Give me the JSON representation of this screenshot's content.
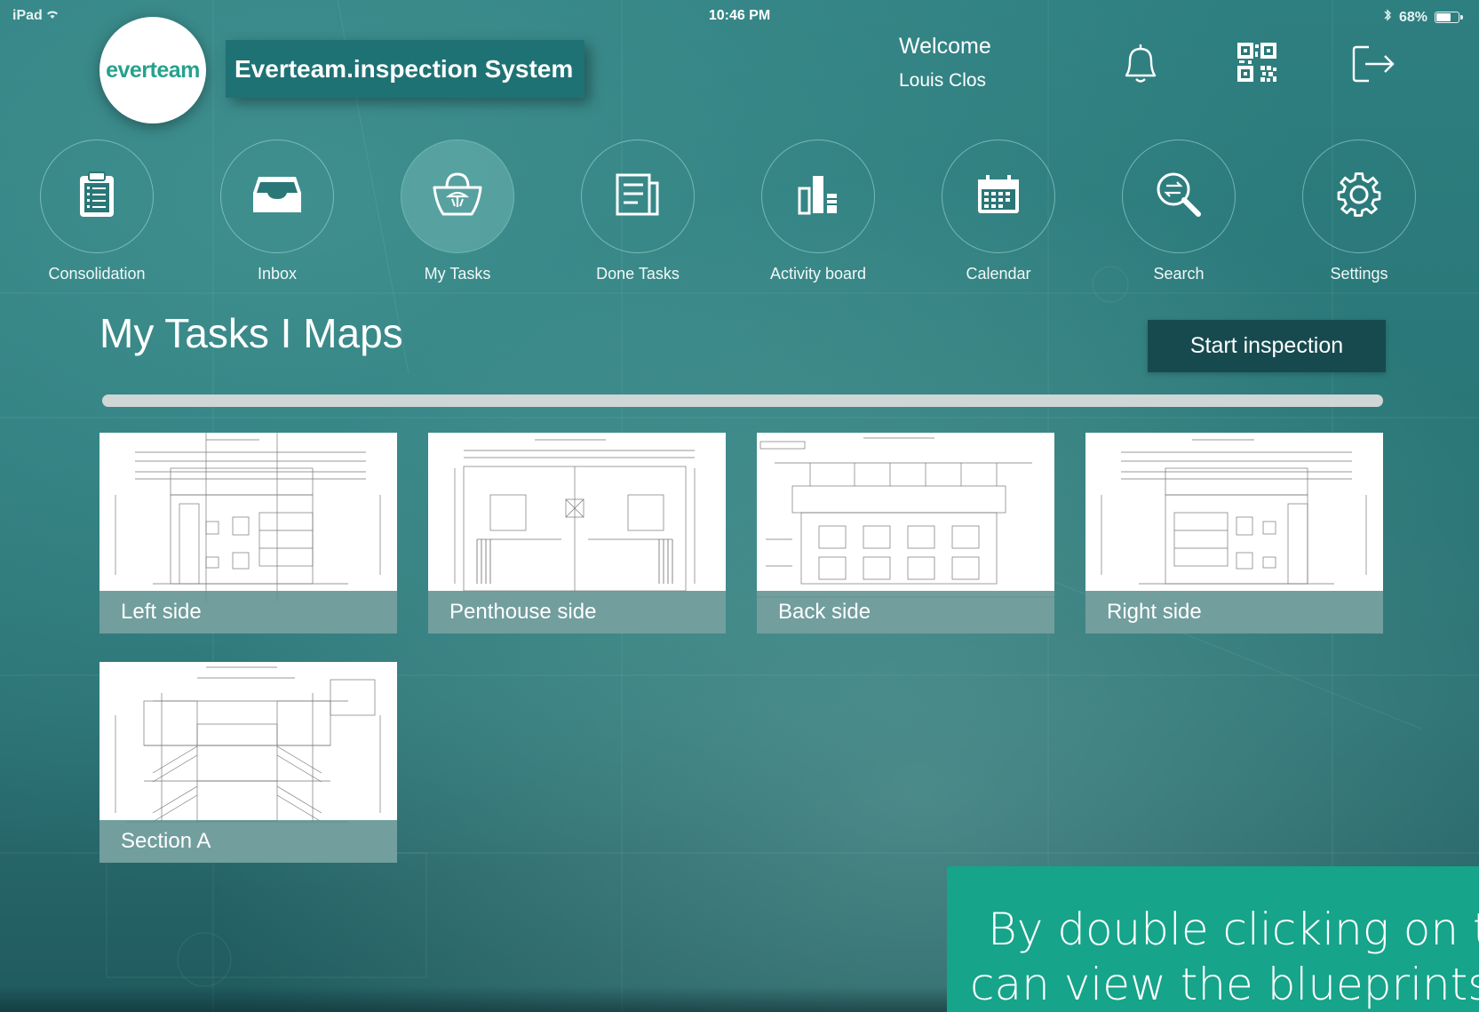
{
  "status_bar": {
    "device": "iPad",
    "time": "10:46 PM",
    "battery": "68%",
    "battery_level": 0.68
  },
  "header": {
    "logo": "everteam",
    "app_title": "Everteam.inspection System",
    "welcome": "Welcome",
    "user_name": "Louis Clos",
    "icons": [
      "bell-icon",
      "qr-code-icon",
      "logout-icon"
    ]
  },
  "nav": {
    "items": [
      {
        "label": "Consolidation",
        "icon": "clipboard-icon"
      },
      {
        "label": "Inbox",
        "icon": "inbox-icon"
      },
      {
        "label": "My Tasks",
        "icon": "basket-icon",
        "active": true
      },
      {
        "label": "Done Tasks",
        "icon": "document-icon"
      },
      {
        "label": "Activity board",
        "icon": "bar-chart-icon"
      },
      {
        "label": "Calendar",
        "icon": "calendar-icon"
      },
      {
        "label": "Search",
        "icon": "search-icon"
      },
      {
        "label": "Settings",
        "icon": "gear-icon"
      }
    ]
  },
  "main": {
    "title": "My Tasks I Maps",
    "start_button": "Start inspection",
    "maps": [
      {
        "label": "Left side"
      },
      {
        "label": "Penthouse side"
      },
      {
        "label": "Back side"
      },
      {
        "label": "Right side"
      },
      {
        "label": "Section A"
      }
    ]
  },
  "caption": {
    "line1": "By double clicking on the",
    "line2": "can view the blueprints re"
  },
  "colors": {
    "accent": "#16a48a",
    "header_box": "#1f7274",
    "button": "#174a4f",
    "background": "#2a7778"
  }
}
